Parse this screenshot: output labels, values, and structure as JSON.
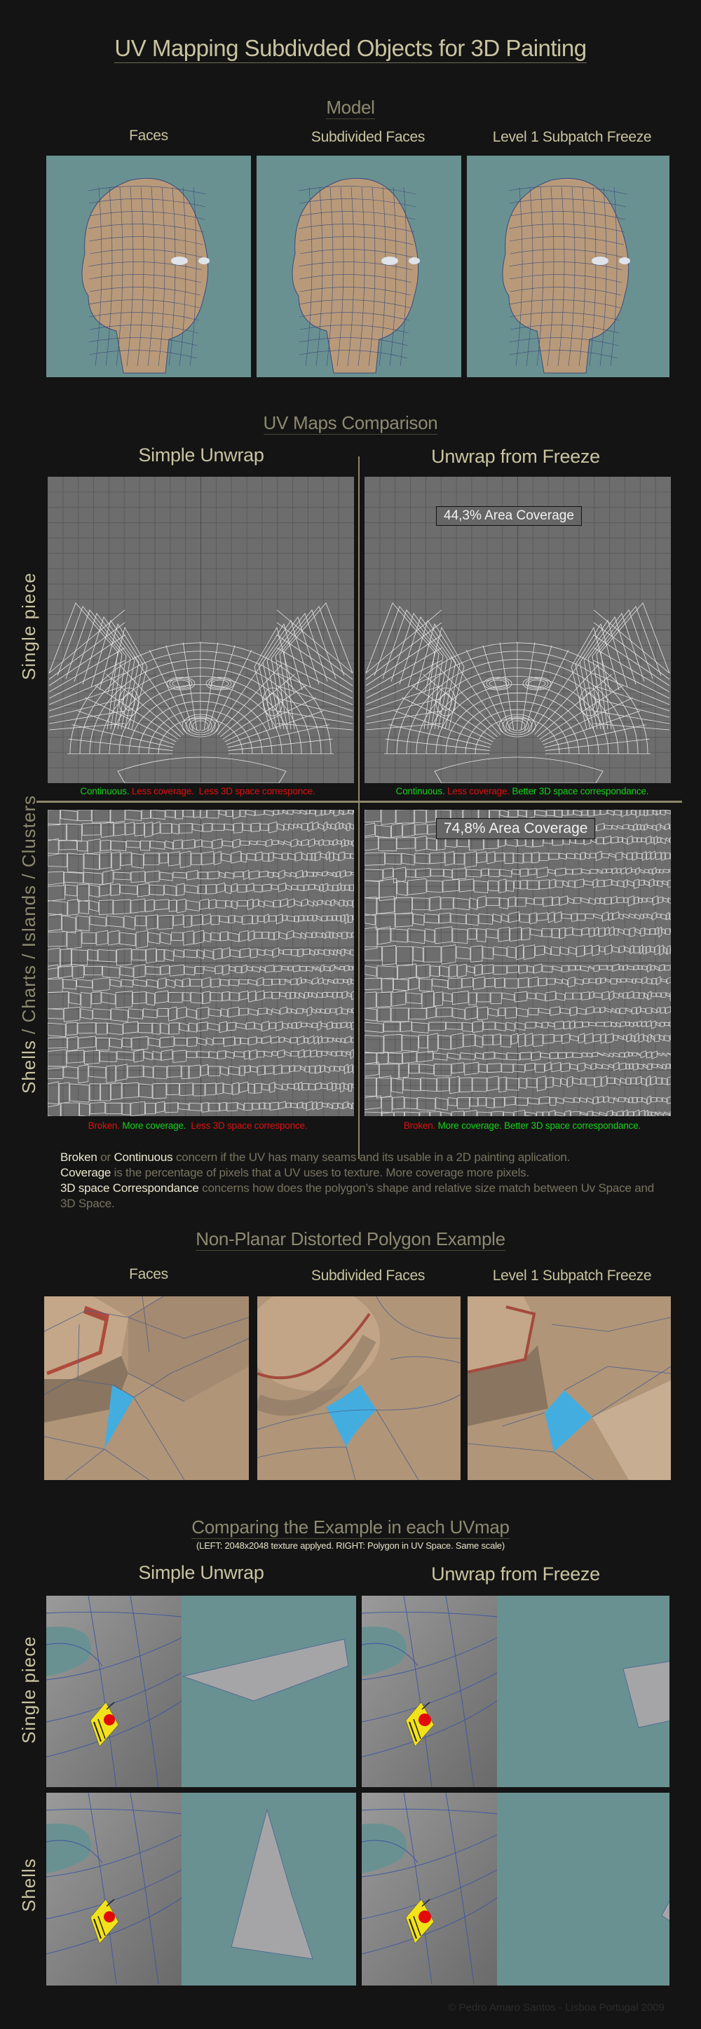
{
  "page": {
    "title": "UV Mapping Subdivded Objects for 3D Painting",
    "footer": "© Pedro Amaro Santos - Lisboa Portugal 2009"
  },
  "model": {
    "section_title": "Model",
    "columns": [
      {
        "label": "Faces"
      },
      {
        "label": "Subdivided Faces"
      },
      {
        "label": "Level 1 Subpatch Freeze"
      }
    ]
  },
  "uv_comparison": {
    "section_title": "UV Maps Comparison",
    "columns": [
      {
        "label": "Simple Unwrap"
      },
      {
        "label": "Unwrap from Freeze"
      }
    ],
    "rows": [
      {
        "label": "Single piece",
        "cells": [
          {
            "coverage": null,
            "caption": [
              {
                "text": "Continuous.",
                "tone": "good"
              },
              {
                "text": " Less coverage.",
                "tone": "bad"
              },
              {
                "text": "  Less 3D space corresponce.",
                "tone": "bad"
              }
            ]
          },
          {
            "coverage": "44,3% Area Coverage",
            "caption": [
              {
                "text": "Continuous.",
                "tone": "good"
              },
              {
                "text": " Less coverage.",
                "tone": "bad"
              },
              {
                "text": " Better 3D space correspondance.",
                "tone": "good"
              }
            ]
          }
        ]
      },
      {
        "label_main": "Shells",
        "label_rest": " / Charts / Islands / Clusters",
        "cells": [
          {
            "coverage": null,
            "caption": [
              {
                "text": "Broken.",
                "tone": "bad"
              },
              {
                "text": " More coverage.",
                "tone": "good"
              },
              {
                "text": "  Less 3D space corresponce.",
                "tone": "bad"
              }
            ]
          },
          {
            "coverage": "74,8% Area Coverage",
            "caption": [
              {
                "text": "Broken.",
                "tone": "bad"
              },
              {
                "text": " More coverage.",
                "tone": "good"
              },
              {
                "text": " Better 3D space correspondance.",
                "tone": "good"
              }
            ]
          }
        ]
      }
    ],
    "colors": {
      "good": "#17d11d",
      "bad": "#e01010"
    }
  },
  "explanation": [
    {
      "parts": [
        {
          "text": "Broken",
          "hl": true
        },
        {
          "text": " or ",
          "hl": false
        },
        {
          "text": "Continuous",
          "hl": true
        },
        {
          "text": " concern if the UV has many seams and its usable in a 2D painting aplication.",
          "hl": false
        }
      ]
    },
    {
      "parts": [
        {
          "text": "Coverage",
          "hl": true
        },
        {
          "text": " is the percentage of pixels that a UV uses to texture. More coverage more pixels.",
          "hl": false
        }
      ]
    },
    {
      "parts": [
        {
          "text": "3D space Correspondance",
          "hl": true
        },
        {
          "text": " concerns how does the polygon’s shape and relative size  match between Uv Space and 3D Space.",
          "hl": false
        }
      ]
    }
  ],
  "nonplanar": {
    "section_title": "Non-Planar Distorted Polygon Example",
    "columns": [
      {
        "label": "Faces"
      },
      {
        "label": "Subdivided Faces"
      },
      {
        "label": "Level 1 Subpatch Freeze"
      }
    ]
  },
  "example_compare": {
    "section_title": "Comparing the Example in each UVmap",
    "subtitle": "(LEFT: 2048x2048 texture applyed. RIGHT: Polygon in UV Space. Same scale)",
    "columns": [
      {
        "label": "Simple Unwrap"
      },
      {
        "label": "Unwrap from Freeze"
      }
    ],
    "rows": [
      {
        "label": "Single piece"
      },
      {
        "label": "Shells"
      }
    ]
  }
}
